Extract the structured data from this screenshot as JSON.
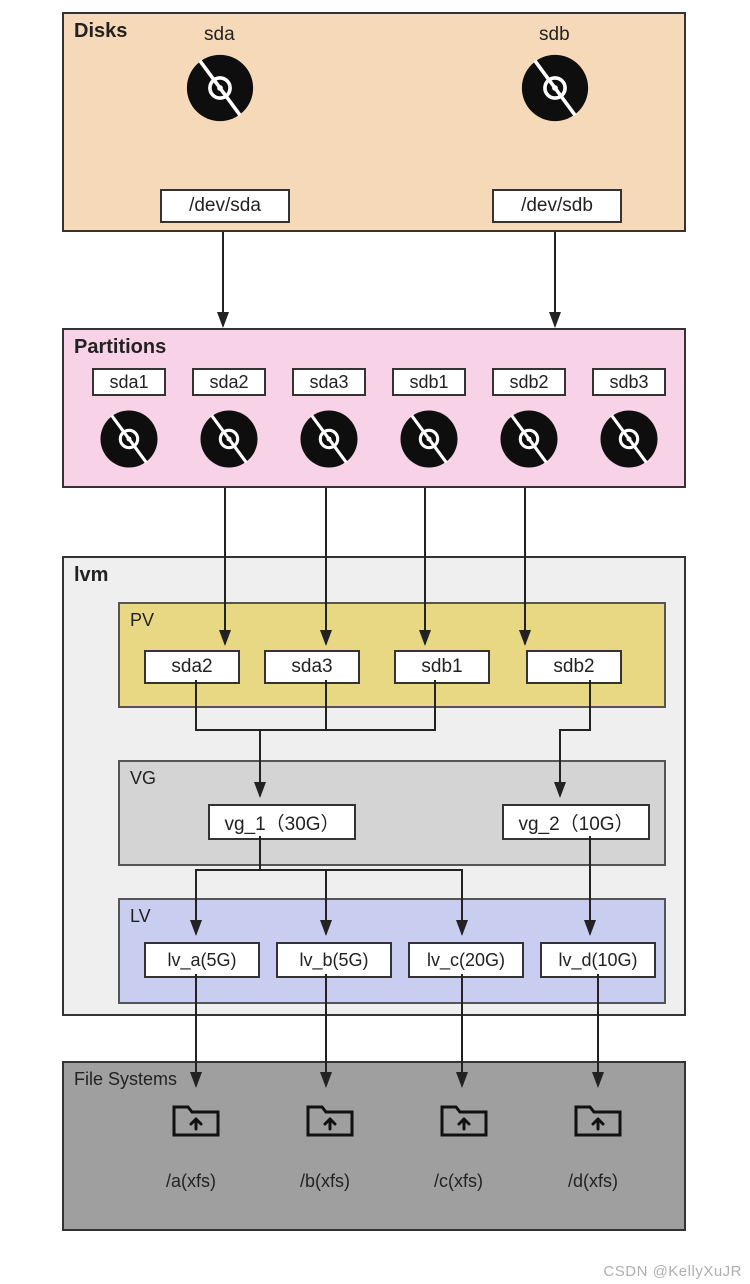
{
  "disks_panel": {
    "title": "Disks",
    "disks": [
      {
        "name": "sda",
        "path": "/dev/sda"
      },
      {
        "name": "sdb",
        "path": "/dev/sdb"
      }
    ]
  },
  "partitions_panel": {
    "title": "Partitions",
    "parts": [
      "sda1",
      "sda2",
      "sda3",
      "sdb1",
      "sdb2",
      "sdb3"
    ]
  },
  "lvm_panel": {
    "title": "lvm",
    "pv": {
      "label": "PV",
      "items": [
        "sda2",
        "sda3",
        "sdb1",
        "sdb2"
      ]
    },
    "vg": {
      "label": "VG",
      "items": [
        "vg_1（30G）",
        "vg_2（10G）"
      ]
    },
    "lv": {
      "label": "LV",
      "items": [
        "lv_a(5G)",
        "lv_b(5G)",
        "lv_c(20G)",
        "lv_d(10G)"
      ]
    }
  },
  "fs_panel": {
    "title": "File Systems",
    "items": [
      "/a(xfs)",
      "/b(xfs)",
      "/c(xfs)",
      "/d(xfs)"
    ]
  },
  "watermark": "CSDN @KellyXuJR",
  "chart_data": {
    "type": "table",
    "title": "LVM storage stack diagram",
    "layers": [
      {
        "name": "Disks",
        "nodes": [
          "sda",
          "sdb"
        ],
        "paths": [
          "/dev/sda",
          "/dev/sdb"
        ]
      },
      {
        "name": "Partitions",
        "nodes": [
          "sda1",
          "sda2",
          "sda3",
          "sdb1",
          "sdb2",
          "sdb3"
        ]
      },
      {
        "name": "PV",
        "nodes": [
          "sda2",
          "sda3",
          "sdb1",
          "sdb2"
        ]
      },
      {
        "name": "VG",
        "nodes": [
          {
            "name": "vg_1",
            "size_gb": 30
          },
          {
            "name": "vg_2",
            "size_gb": 10
          }
        ]
      },
      {
        "name": "LV",
        "nodes": [
          {
            "name": "lv_a",
            "size_gb": 5
          },
          {
            "name": "lv_b",
            "size_gb": 5
          },
          {
            "name": "lv_c",
            "size_gb": 20
          },
          {
            "name": "lv_d",
            "size_gb": 10
          }
        ]
      },
      {
        "name": "File Systems",
        "nodes": [
          {
            "mount": "/a",
            "fs": "xfs"
          },
          {
            "mount": "/b",
            "fs": "xfs"
          },
          {
            "mount": "/c",
            "fs": "xfs"
          },
          {
            "mount": "/d",
            "fs": "xfs"
          }
        ]
      }
    ],
    "edges": [
      [
        "sda",
        "sda1"
      ],
      [
        "sda",
        "sda2"
      ],
      [
        "sda",
        "sda3"
      ],
      [
        "sdb",
        "sdb1"
      ],
      [
        "sdb",
        "sdb2"
      ],
      [
        "sdb",
        "sdb3"
      ],
      [
        "sda2",
        "PV:sda2"
      ],
      [
        "sda3",
        "PV:sda3"
      ],
      [
        "sdb1",
        "PV:sdb1"
      ],
      [
        "sdb2",
        "PV:sdb2"
      ],
      [
        "PV:sda2",
        "vg_1"
      ],
      [
        "PV:sda3",
        "vg_1"
      ],
      [
        "PV:sdb1",
        "vg_1"
      ],
      [
        "PV:sdb2",
        "vg_2"
      ],
      [
        "vg_1",
        "lv_a"
      ],
      [
        "vg_1",
        "lv_b"
      ],
      [
        "vg_1",
        "lv_c"
      ],
      [
        "vg_2",
        "lv_d"
      ],
      [
        "lv_a",
        "/a"
      ],
      [
        "lv_b",
        "/b"
      ],
      [
        "lv_c",
        "/c"
      ],
      [
        "lv_d",
        "/d"
      ]
    ]
  }
}
